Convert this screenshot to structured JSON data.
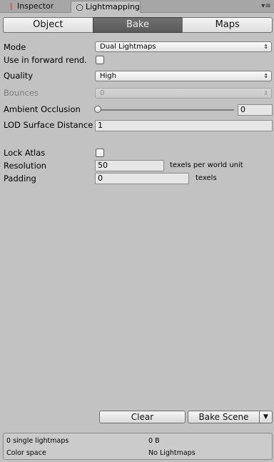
{
  "tabs": {
    "inspector": {
      "label": "Inspector",
      "icon": "info-icon"
    },
    "lightmapping": {
      "label": "Lightmapping",
      "icon": "lightbulb-icon"
    }
  },
  "toolbar": {
    "modes": [
      {
        "label": "Object",
        "selected": false
      },
      {
        "label": "Bake",
        "selected": true
      },
      {
        "label": "Maps",
        "selected": false
      }
    ]
  },
  "settings": {
    "mode": {
      "label": "Mode",
      "value": "Dual Lightmaps"
    },
    "forward": {
      "label": "Use in forward rend.",
      "checked": false
    },
    "quality": {
      "label": "Quality",
      "value": "High"
    },
    "bounces": {
      "label": "Bounces",
      "value": "0",
      "enabled": false
    },
    "ao": {
      "label": "Ambient Occlusion",
      "value": "0",
      "fraction": 0
    },
    "lod": {
      "label": "LOD Surface Distance",
      "value": "1"
    },
    "lock_atlas": {
      "label": "Lock Atlas",
      "checked": false
    },
    "resolution": {
      "label": "Resolution",
      "value": "50",
      "suffix": "texels per world unit"
    },
    "padding": {
      "label": "Padding",
      "value": "0",
      "suffix": "texels"
    }
  },
  "actions": {
    "clear": "Clear",
    "bake_scene": "Bake Scene"
  },
  "status": {
    "lightmaps": "0 single lightmaps",
    "size": "0 B",
    "color_space_label": "Color space",
    "color_space_value": "No Lightmaps"
  },
  "colors": {
    "background": "#c2c2c2",
    "selected_segment": "#646464",
    "disabled_text": "#7d7d7d"
  }
}
